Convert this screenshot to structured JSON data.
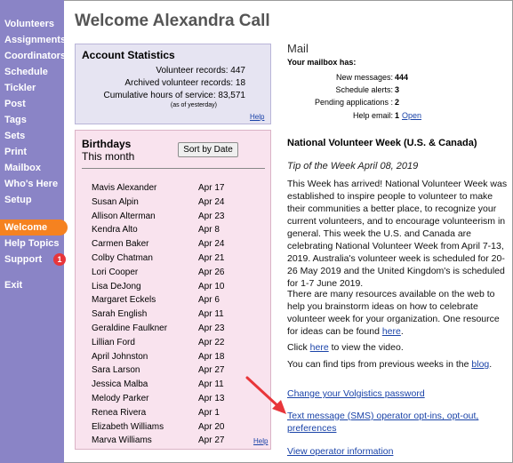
{
  "sidebar": {
    "items": [
      {
        "label": "Volunteers"
      },
      {
        "label": "Assignments"
      },
      {
        "label": "Coordinators"
      },
      {
        "label": "Schedule"
      },
      {
        "label": "Tickler"
      },
      {
        "label": "Post"
      },
      {
        "label": "Tags"
      },
      {
        "label": "Sets"
      },
      {
        "label": "Print"
      },
      {
        "label": "Mailbox"
      },
      {
        "label": "Who's Here"
      },
      {
        "label": "Setup"
      },
      {
        "label": "Welcome",
        "active": true
      },
      {
        "label": "Help Topics"
      },
      {
        "label": "Support",
        "badge": "1"
      },
      {
        "label": "Exit"
      }
    ],
    "colors": {
      "background": "#8a84c6",
      "active": "#f58220",
      "badge": "#e8363a"
    }
  },
  "page_title": "Welcome Alexandra Call",
  "account_stats": {
    "title": "Account Statistics",
    "rows": [
      {
        "text": "Volunteer records: 447"
      },
      {
        "text": "Archived volunteer records: 18"
      },
      {
        "text": "Cumulative hours of service: 83,571"
      }
    ],
    "note": "(as of yesterday)",
    "help": "Help"
  },
  "birthdays": {
    "title": "Birthdays",
    "subtitle": "This month",
    "sort_button": "Sort by Date",
    "people": [
      {
        "name": "Mavis Alexander",
        "date": "Apr 17"
      },
      {
        "name": "Susan Alpin",
        "date": "Apr 24"
      },
      {
        "name": "Allison Alterman",
        "date": "Apr 23"
      },
      {
        "name": "Kendra Alto",
        "date": "Apr 8"
      },
      {
        "name": "Carmen Baker",
        "date": "Apr 24"
      },
      {
        "name": "Colby Chatman",
        "date": "Apr 21"
      },
      {
        "name": "Lori Cooper",
        "date": "Apr 26"
      },
      {
        "name": "Lisa DeJong",
        "date": "Apr 10"
      },
      {
        "name": "Margaret Eckels",
        "date": "Apr 6"
      },
      {
        "name": "Sarah English",
        "date": "Apr 11"
      },
      {
        "name": "Geraldine Faulkner",
        "date": "Apr 23"
      },
      {
        "name": "Lillian Ford",
        "date": "Apr 22"
      },
      {
        "name": "April Johnston",
        "date": "Apr 18"
      },
      {
        "name": "Sara Larson",
        "date": "Apr 27"
      },
      {
        "name": "Jessica Malba",
        "date": "Apr 11"
      },
      {
        "name": "Melody Parker",
        "date": "Apr 13"
      },
      {
        "name": "Renea Rivera",
        "date": "Apr 1"
      },
      {
        "name": "Elizabeth Williams",
        "date": "Apr 20"
      },
      {
        "name": "Marva Williams",
        "date": "Apr 27"
      }
    ],
    "help": "Help"
  },
  "mail": {
    "title": "Mail",
    "subtitle": "Your mailbox has:",
    "rows": [
      {
        "label": "New messages:",
        "value": "444"
      },
      {
        "label": "Schedule alerts:",
        "value": "3"
      },
      {
        "label": "Pending applications :",
        "value": "2"
      },
      {
        "label": "Help email:",
        "value": "1",
        "link": "Open"
      }
    ]
  },
  "news": {
    "title": "National Volunteer Week (U.S. & Canada)",
    "tip": "Tip of the Week April 08, 2019",
    "p1": "This Week has arrived! National Volunteer Week was established to inspire people to volunteer to make their communities a better place, to recognize your current volunteers, and to encourage volunteerism in general. This week the U.S. and Canada are celebrating National Volunteer Week from April 7-13, 2019. Australia's volunteer week is scheduled for 20-26 May 2019 and the United Kingdom's is scheduled for 1-7 June 2019.",
    "p2_text": "There are many resources available on the web to help you brainstorm ideas on how to celebrate volunteer week for your organization. One resource for ideas can be found ",
    "p2_link": "here",
    "p2_end": ".",
    "p3_start": "Click ",
    "p3_link": "here",
    "p3_end": " to view the video.",
    "p4_text": "You can find tips from previous weeks in the ",
    "p4_link": "blog",
    "p4_end": "."
  },
  "links": {
    "change_password": "Change your Volgistics password",
    "sms": "Text message (SMS) operator opt-ins, opt-out, preferences",
    "operator_info": "View operator information"
  },
  "arrow_color": "#e8363a"
}
